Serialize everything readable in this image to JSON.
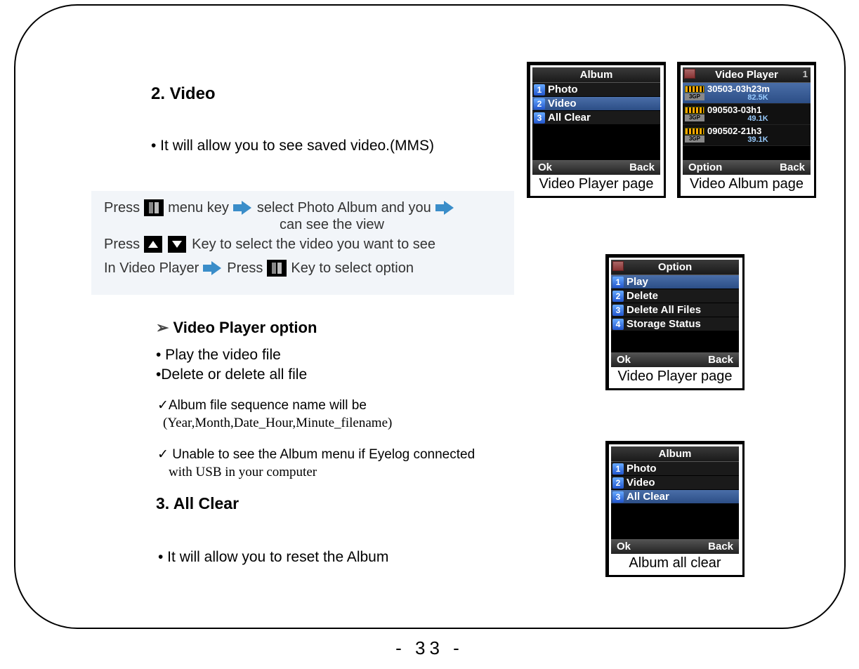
{
  "page_number": "- 33 -",
  "section": {
    "video_heading": "2. Video",
    "video_intro": "• It  will allow you to see saved video.(MMS)",
    "instr": {
      "l1a": "Press",
      "l1b": "menu key",
      "l1c": "select Photo Album and you",
      "l1d": "can see the view",
      "l2a": "Press",
      "l2b": "Key to select the video you want to see",
      "l3a": "In Video Player",
      "l3b": "Press",
      "l3c": "Key to select option"
    },
    "sub_heading": "Video Player option",
    "opt1": "• Play the video file",
    "opt2": "•Delete or delete all file",
    "note1a": "✓Album file sequence name  will be",
    "note1b": "(Year,Month,Date_Hour,Minute_filename)",
    "note2a": "✓ Unable to see the Album menu if Eyelog connected",
    "note2b": "with USB in your computer",
    "clear_heading": "3. All Clear",
    "clear_intro": "• It  will allow you to reset the Album"
  },
  "phones": {
    "album1": {
      "title": "Album",
      "items": [
        "Photo",
        "Video",
        "All Clear"
      ],
      "selected": 1,
      "ok": "Ok",
      "back": "Back",
      "caption": "Video Player page"
    },
    "videoplayer": {
      "title": "Video Player",
      "count": "1",
      "files": [
        {
          "name": "30503-03h23m",
          "size": "82.5K"
        },
        {
          "name": "090503-03h1",
          "size": "49.1K"
        },
        {
          "name": "090502-21h3",
          "size": "39.1K"
        }
      ],
      "selected": 0,
      "opt": "Option",
      "back": "Back",
      "caption": "Video Album page"
    },
    "option": {
      "title": "Option",
      "items": [
        "Play",
        "Delete",
        "Delete All Files",
        "Storage Status"
      ],
      "selected": 0,
      "ok": "Ok",
      "back": "Back",
      "caption": "Video Player page"
    },
    "album2": {
      "title": "Album",
      "items": [
        "Photo",
        "Video",
        "All Clear"
      ],
      "selected": 2,
      "ok": "Ok",
      "back": "Back",
      "caption": "Album all clear"
    }
  }
}
